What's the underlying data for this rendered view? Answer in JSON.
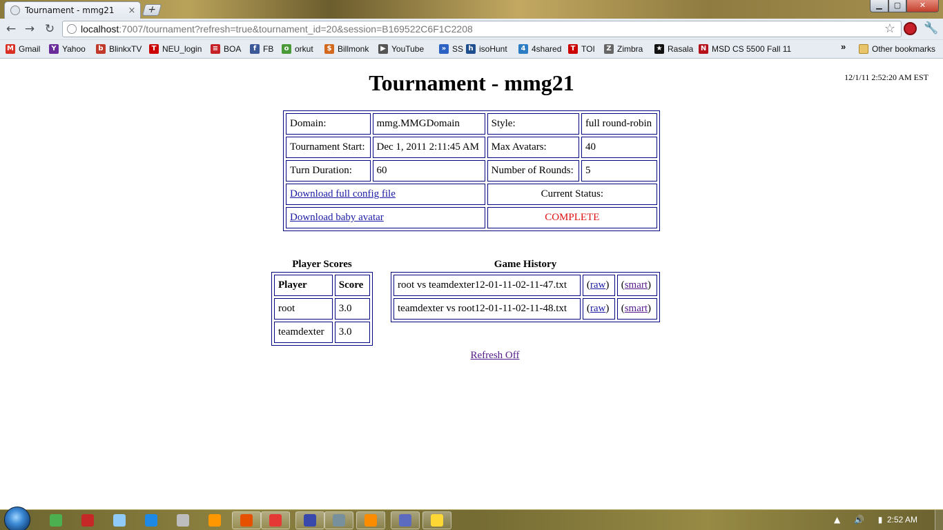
{
  "browser": {
    "tab_title": "Tournament - mmg21",
    "tab_close": "×",
    "new_tab": "+",
    "window_controls": {
      "minimize": "▁",
      "maximize": "▢",
      "close": "✕"
    },
    "nav": {
      "back": "←",
      "forward": "→",
      "reload": "↻"
    },
    "url_host": "localhost",
    "url_rest": ":7007/tournament?refresh=true&tournament_id=20&session=B169522C6F1C2208",
    "star": "☆",
    "wrench": "🔧"
  },
  "bookmarks": [
    {
      "label": "Gmail",
      "icon": "gmail-icon",
      "color": "#d93025",
      "glyph": "M"
    },
    {
      "label": "Yahoo",
      "icon": "yahoo-icon",
      "color": "#6b2c9b",
      "glyph": "Y"
    },
    {
      "label": "BlinkxTV",
      "icon": "blinkx-icon",
      "color": "#c0392b",
      "glyph": "b"
    },
    {
      "label": "NEU_login",
      "icon": "toi-icon",
      "color": "#cc0000",
      "glyph": "T"
    },
    {
      "label": "BOA",
      "icon": "boa-icon",
      "color": "#c62127",
      "glyph": "≡"
    },
    {
      "label": "FB",
      "icon": "facebook-icon",
      "color": "#3b5998",
      "glyph": "f"
    },
    {
      "label": "orkut",
      "icon": "orkut-icon",
      "color": "#4a9a3a",
      "glyph": "o"
    },
    {
      "label": "Billmonk",
      "icon": "billmonk-icon",
      "color": "#d2691e",
      "glyph": "$"
    },
    {
      "label": "YouTube",
      "icon": "youtube-icon",
      "color": "#555555",
      "glyph": "▶"
    },
    {
      "label": "SS",
      "icon": "ss-icon",
      "color": "#2b62c4",
      "glyph": "»"
    },
    {
      "label": "isoHunt",
      "icon": "isohunt-icon",
      "color": "#1f4f8f",
      "glyph": "h"
    },
    {
      "label": "4shared",
      "icon": "4shared-icon",
      "color": "#2c7cc4",
      "glyph": "4"
    },
    {
      "label": "TOI",
      "icon": "toi-icon",
      "color": "#cc0000",
      "glyph": "T"
    },
    {
      "label": "Zimbra",
      "icon": "zimbra-icon",
      "color": "#666666",
      "glyph": "Z"
    },
    {
      "label": "Rasala",
      "icon": "star-icon",
      "color": "#111111",
      "glyph": "★"
    },
    {
      "label": "MSD CS 5500 Fall 11",
      "icon": "neu-icon",
      "color": "#b5121b",
      "glyph": "N"
    }
  ],
  "bookmarks_more": "»",
  "other_bookmarks": "Other bookmarks",
  "page": {
    "title": "Tournament - mmg21",
    "timestamp": "12/1/11 2:52:20 AM EST",
    "info": {
      "domain_label": "Domain:",
      "domain_value": "mmg.MMGDomain",
      "style_label": "Style:",
      "style_value": "full round-robin",
      "start_label": "Tournament Start:",
      "start_value": "Dec 1, 2011 2:11:45 AM",
      "max_avatars_label": "Max Avatars:",
      "max_avatars_value": "40",
      "turn_label": "Turn Duration:",
      "turn_value": "60",
      "rounds_label": "Number of Rounds:",
      "rounds_value": "5",
      "download_config": "Download full config file",
      "status_label": "Current Status:",
      "download_avatar": "Download baby avatar",
      "status_value": "COMPLETE",
      "status_color": "#e01010"
    },
    "scores": {
      "title": "Player Scores",
      "headers": [
        "Player",
        "Score"
      ],
      "rows": [
        {
          "player": "root",
          "score": "3.0"
        },
        {
          "player": "teamdexter",
          "score": "3.0"
        }
      ]
    },
    "history": {
      "title": "Game History",
      "rows": [
        {
          "game": "root vs teamdexter12-01-11-02-11-47.txt",
          "raw": "raw",
          "smart": "smart"
        },
        {
          "game": "teamdexter vs root12-01-11-02-11-48.txt",
          "raw": "raw",
          "smart": "smart"
        }
      ]
    },
    "refresh_link": "Refresh Off"
  },
  "taskbar": {
    "clock": "2:52 AM",
    "tray": "▲ 🔊 ▮",
    "apps": [
      {
        "name": "taskbar-app-network",
        "color": "#4caf50"
      },
      {
        "name": "taskbar-app-filezilla",
        "color": "#c62828"
      },
      {
        "name": "taskbar-app-notepad",
        "color": "#90caf9"
      },
      {
        "name": "taskbar-app-ie",
        "color": "#1e88e5"
      },
      {
        "name": "taskbar-app-editor",
        "color": "#bdbdbd"
      },
      {
        "name": "taskbar-app-media",
        "color": "#ff9800"
      },
      {
        "name": "taskbar-app-firefox",
        "color": "#e65100"
      },
      {
        "name": "taskbar-app-chrome",
        "color": "#e53935"
      },
      {
        "name": "taskbar-app-eclipse",
        "color": "#3949ab"
      },
      {
        "name": "taskbar-app-tool",
        "color": "#78909c"
      },
      {
        "name": "taskbar-app-installer",
        "color": "#fb8c00"
      },
      {
        "name": "taskbar-app-remote",
        "color": "#5c6bc0"
      },
      {
        "name": "taskbar-app-explorer",
        "color": "#fdd835"
      }
    ]
  }
}
